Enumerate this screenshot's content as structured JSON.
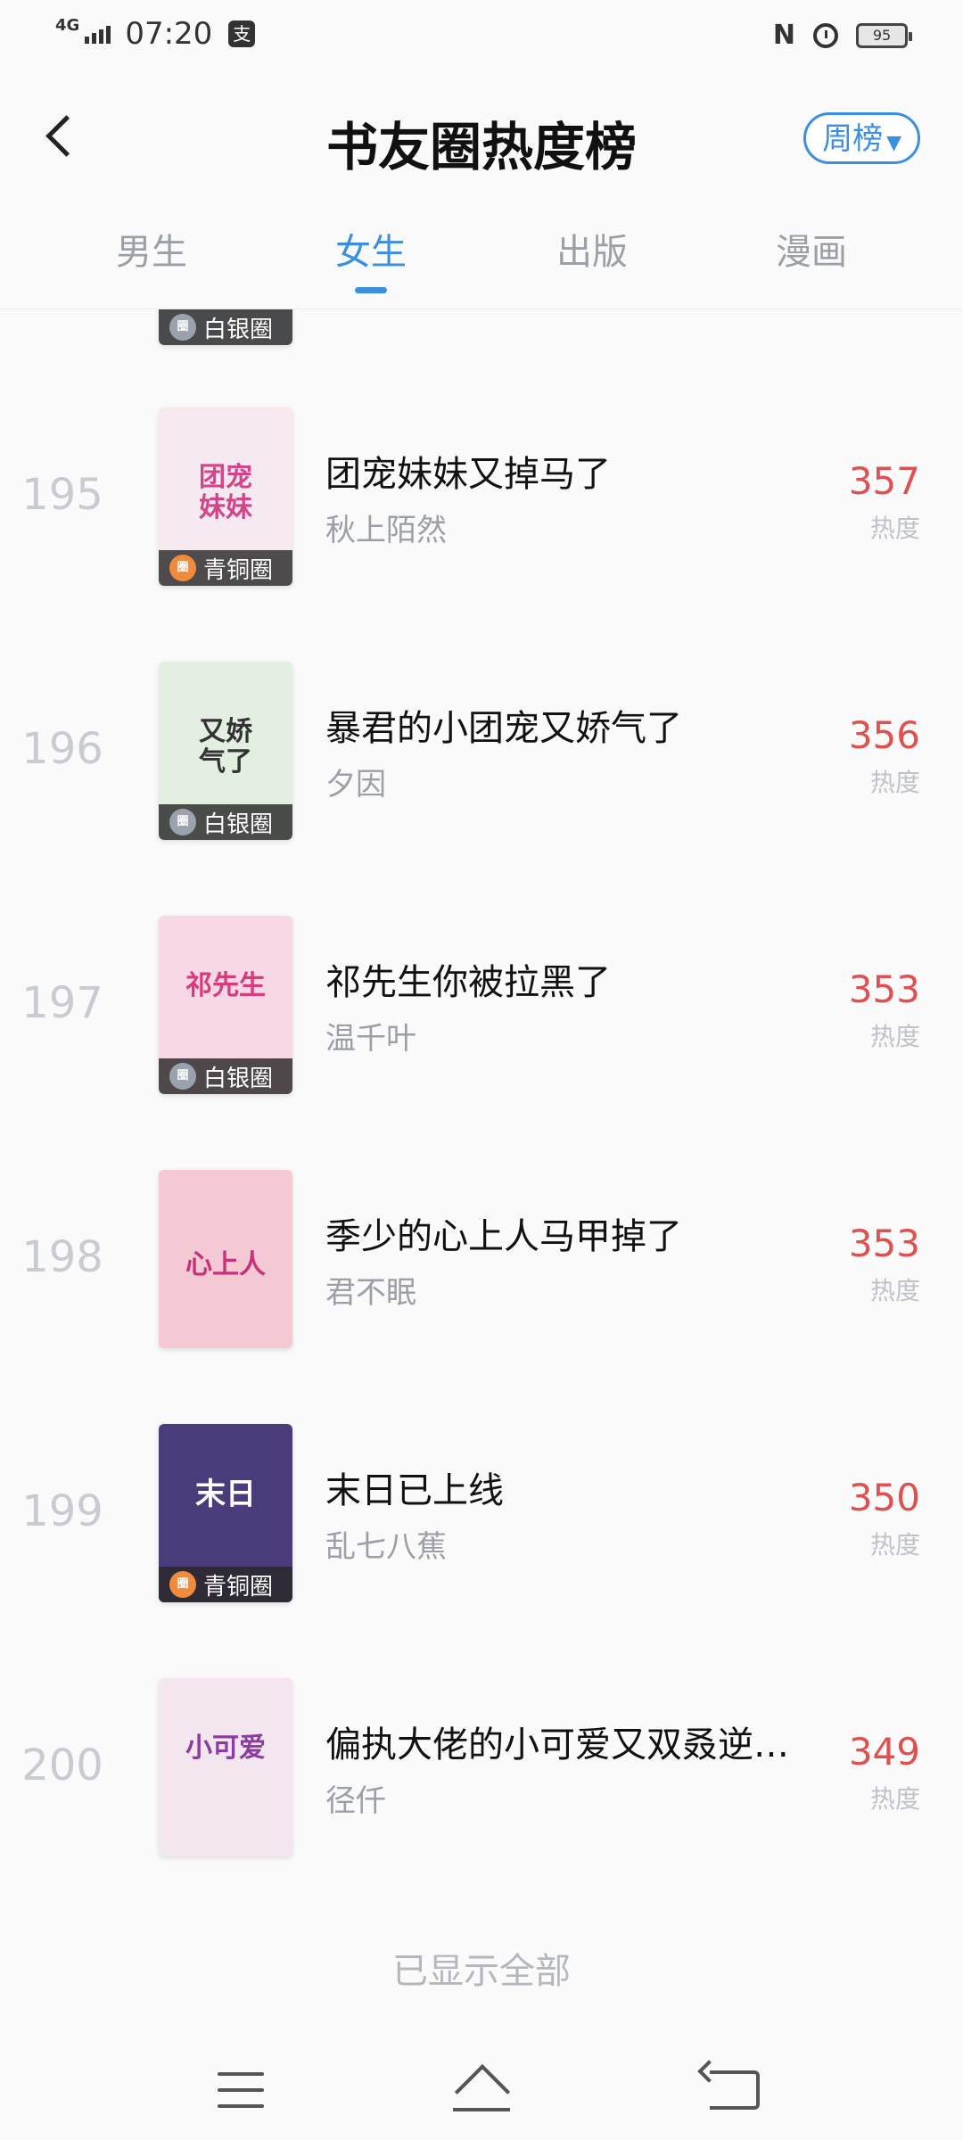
{
  "status_bar": {
    "network": "4G",
    "time": "07:20",
    "pay_icon": "支",
    "battery": "95"
  },
  "header": {
    "title": "书友圈热度榜",
    "period_button": "周榜",
    "period_caret": "▼"
  },
  "tabs": [
    {
      "label": "男生",
      "active": false
    },
    {
      "label": "女生",
      "active": true
    },
    {
      "label": "出版",
      "active": false
    },
    {
      "label": "漫画",
      "active": false
    }
  ],
  "partial_row": {
    "badge": "白银圈"
  },
  "books": [
    {
      "rank": "195",
      "title": "团宠妹妹又掉马了",
      "author": "秋上陌然",
      "heat": "357",
      "heat_label": "热度",
      "badge": "青铜圈",
      "badge_type": "bronze",
      "cover_color": "#f6e9ef"
    },
    {
      "rank": "196",
      "title": "暴君的小团宠又娇气了",
      "author": "夕因",
      "heat": "356",
      "heat_label": "热度",
      "badge": "白银圈",
      "badge_type": "silver",
      "cover_color": "#e3efe0"
    },
    {
      "rank": "197",
      "title": "祁先生你被拉黑了",
      "author": "温千叶",
      "heat": "353",
      "heat_label": "热度",
      "badge": "白银圈",
      "badge_type": "silver",
      "cover_color": "#f7d8e4"
    },
    {
      "rank": "198",
      "title": "季少的心上人马甲掉了",
      "author": "君不眠",
      "heat": "353",
      "heat_label": "热度",
      "badge": "",
      "badge_type": "none",
      "cover_color": "#f4c9d3"
    },
    {
      "rank": "199",
      "title": "末日已上线",
      "author": "乱七八蕉",
      "heat": "350",
      "heat_label": "热度",
      "badge": "青铜圈",
      "badge_type": "bronze",
      "cover_color": "#4a3b7a"
    },
    {
      "rank": "200",
      "title": "偏执大佬的小可爱又双叒逆…",
      "author": "径仟",
      "heat": "349",
      "heat_label": "热度",
      "badge": "",
      "badge_type": "none",
      "cover_color": "#f3e6ef"
    }
  ],
  "footer": {
    "all_shown": "已显示全部"
  }
}
